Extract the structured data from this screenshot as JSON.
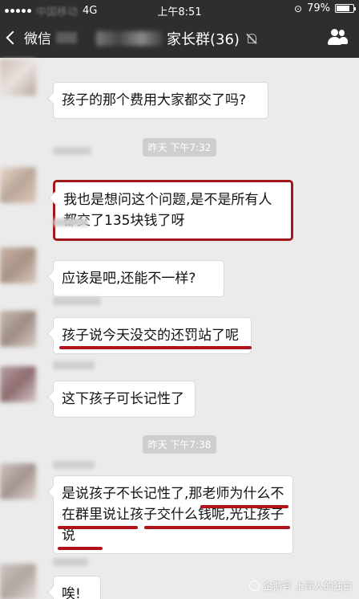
{
  "status_bar": {
    "carrier": "中国移动",
    "network": "4G",
    "time": "上午8:51",
    "battery_text": "79%",
    "battery_level": 0.79
  },
  "nav": {
    "back_label": "微信",
    "title": "家长群(36)"
  },
  "messages": [
    {
      "text": "孩子的那个费用大家都交了吗?"
    },
    {
      "text": "我也是想问这个问题,是不是所有人都交了135块钱了呀"
    },
    {
      "text": "应该是吧,还能不一样?"
    },
    {
      "text": "孩子说今天没交的还罚站了呢"
    },
    {
      "text": "这下孩子可长记性了"
    },
    {
      "text": "是说孩子不长记性了,那老师为什么不在群里说让孩子交什么钱呢,光让孩子说"
    },
    {
      "text": "唉!"
    }
  ],
  "timestamps": [
    "昨天 下午7:32",
    "昨天 下午7:38"
  ],
  "watermark": "企鹅号 上岸人的独白",
  "colors": {
    "highlight": "#a3171a",
    "chat_bg": "#ebebeb",
    "bar_bg": "#2e2e2e"
  }
}
